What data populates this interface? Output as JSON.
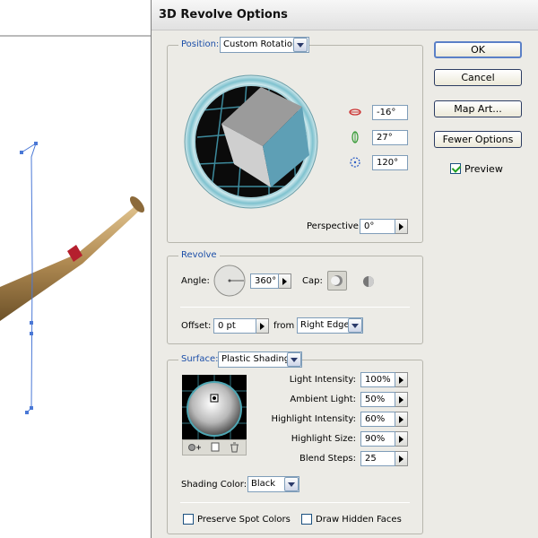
{
  "dialog": {
    "title": "3D Revolve Options"
  },
  "position": {
    "label": "Position:",
    "preset": "Custom Rotation",
    "x_angle": "-16°",
    "y_angle": "27°",
    "z_angle": "120°",
    "perspective_label": "Perspective:",
    "perspective_value": "0°"
  },
  "revolve": {
    "label": "Revolve",
    "angle_label": "Angle:",
    "angle_value": "360°",
    "cap_label": "Cap:",
    "offset_label": "Offset:",
    "offset_value": "0 pt",
    "from_label": "from",
    "from_value": "Right Edge"
  },
  "surface": {
    "label": "Surface:",
    "preset": "Plastic Shading",
    "light_intensity_label": "Light Intensity:",
    "light_intensity_value": "100%",
    "ambient_light_label": "Ambient Light:",
    "ambient_light_value": "50%",
    "highlight_intensity_label": "Highlight Intensity:",
    "highlight_intensity_value": "60%",
    "highlight_size_label": "Highlight Size:",
    "highlight_size_value": "90%",
    "blend_steps_label": "Blend Steps:",
    "blend_steps_value": "25",
    "shading_color_label": "Shading Color:",
    "shading_color_value": "Black",
    "preserve_spot_label": "Preserve Spot Colors",
    "draw_hidden_label": "Draw Hidden Faces"
  },
  "buttons": {
    "ok": "OK",
    "cancel": "Cancel",
    "map_art": "Map Art...",
    "fewer_options": "Fewer Options",
    "preview": "Preview"
  },
  "colors": {
    "legend": "#1b4ea8",
    "cube_front": "#5e9fb5",
    "bat": "#b08a52",
    "path": "#4a78d6"
  }
}
